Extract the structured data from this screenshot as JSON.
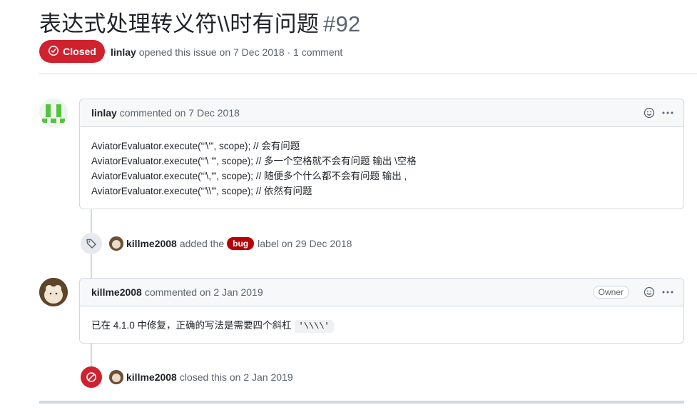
{
  "issue": {
    "title": "表达式处理转义符\\\\时有问题",
    "number": "#92",
    "state": "Closed",
    "author": "linlay",
    "opened_text": "opened this issue on 7 Dec 2018 · 1 comment"
  },
  "comment1": {
    "author": "linlay",
    "action": "commented on 7 Dec 2018",
    "lines": [
      "AviatorEvaluator.execute(“'\\'”, scope); // 会有问题",
      "AviatorEvaluator.execute(“'\\ '”, scope); // 多一个空格就不会有问题 输出 \\空格",
      "AviatorEvaluator.execute(“'\\,'”, scope); // 随便多个什么都不会有问题 输出 ,",
      "AviatorEvaluator.execute(“'\\\\'”, scope); // 依然有问题"
    ]
  },
  "event_label": {
    "actor": "killme2008",
    "before": "added the",
    "label": "bug",
    "after": "label on 29 Dec 2018"
  },
  "comment2": {
    "author": "killme2008",
    "action": "commented on 2 Jan 2019",
    "badge": "Owner",
    "text": "已在 4.1.0 中修复，正确的写法是需要四个斜杠",
    "code": "'\\\\\\\\'"
  },
  "event_closed": {
    "actor": "killme2008",
    "text": "closed this on 2 Jan 2019"
  },
  "colors": {
    "closed_red": "#cf222e",
    "bug_label": "#b60205",
    "border": "#d1d9e0"
  }
}
